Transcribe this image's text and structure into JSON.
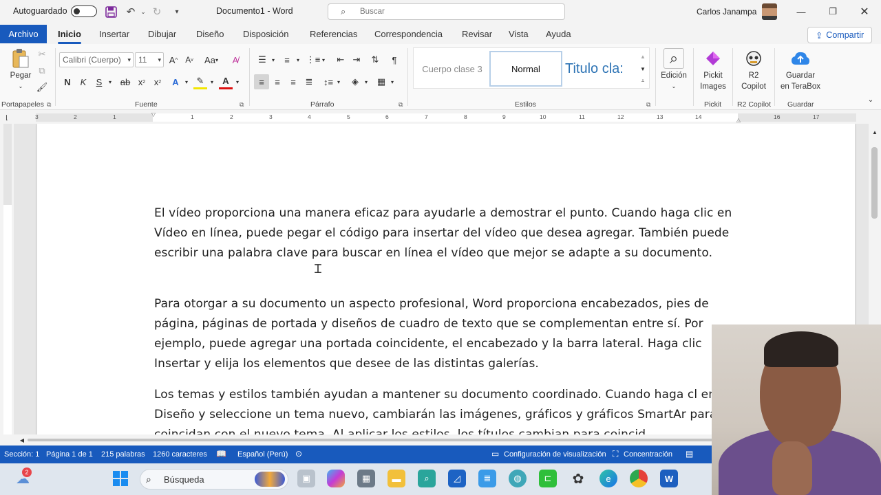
{
  "titlebar": {
    "autosave_label": "Autoguardado",
    "doc_title": "Documento1  -  Word",
    "search_placeholder": "Buscar",
    "user_name": "Carlos Janampa"
  },
  "tabs": {
    "file": "Archivo",
    "items": [
      "Inicio",
      "Insertar",
      "Dibujar",
      "Diseño",
      "Disposición",
      "Referencias",
      "Correspondencia",
      "Revisar",
      "Vista",
      "Ayuda"
    ],
    "active": "Inicio",
    "share_label": "Compartir"
  },
  "ribbon": {
    "clipboard": {
      "paste_label": "Pegar",
      "group_label": "Portapapeles"
    },
    "font": {
      "font_name": "Calibri (Cuerpo)",
      "font_size": "11",
      "group_label": "Fuente",
      "change_case": "Aa"
    },
    "paragraph": {
      "group_label": "Párrafo"
    },
    "styles": {
      "items": [
        "Cuerpo clase 3",
        "Normal",
        "Titulo cla:"
      ],
      "group_label": "Estilos"
    },
    "editing": {
      "label": "Edición"
    },
    "pickit": {
      "label_line1": "Pickit",
      "label_line2": "Images",
      "group_label": "Pickit"
    },
    "r2": {
      "label_line1": "R2",
      "label_line2": "Copilot",
      "group_label": "R2 Copilot"
    },
    "terabox": {
      "label_line1": "Guardar",
      "label_line2": "en TeraBox",
      "group_label": "Guardar"
    }
  },
  "ruler": {
    "numbers": [
      "3",
      "2",
      "1",
      "1",
      "1",
      "2",
      "3",
      "4",
      "5",
      "6",
      "7",
      "8",
      "9",
      "10",
      "11",
      "12",
      "13",
      "14",
      "16",
      "17"
    ]
  },
  "document": {
    "paragraphs": [
      "El vídeo proporciona una manera eficaz para ayudarle a demostrar el punto. Cuando haga clic en Vídeo en línea, puede pegar el código para insertar del vídeo que desea agregar. También puede escribir una palabra clave para buscar en línea el vídeo que mejor se adapte a su documento.",
      "Para otorgar a su documento un aspecto profesional, Word proporciona encabezados, pies de página, páginas de portada y diseños de cuadro de texto que se complementan entre sí. Por ejemplo, puede agregar una portada coincidente, el encabezado y la barra lateral. Haga clic Insertar y elija los elementos que desee de las distintas galerías.",
      "Los temas y estilos también ayudan a mantener su documento coordinado. Cuando haga cl en Diseño y seleccione un tema nuevo, cambiarán las imágenes, gráficos y gráficos SmartAr para que coincidan con el nuevo tema. Al aplicar los estilos, los títulos cambian para coincid"
    ]
  },
  "statusbar": {
    "section": "Sección: 1",
    "page": "Página 1 de 1",
    "words": "215 palabras",
    "chars": "1260 caracteres",
    "language": "Español (Perú)",
    "display_settings": "Configuración de visualización",
    "focus": "Concentración"
  },
  "taskbar": {
    "search_label": "Búsqueda",
    "notification_count": "2"
  },
  "colors": {
    "accent": "#185abd",
    "taskbar_bg": "#dfe6ee"
  }
}
